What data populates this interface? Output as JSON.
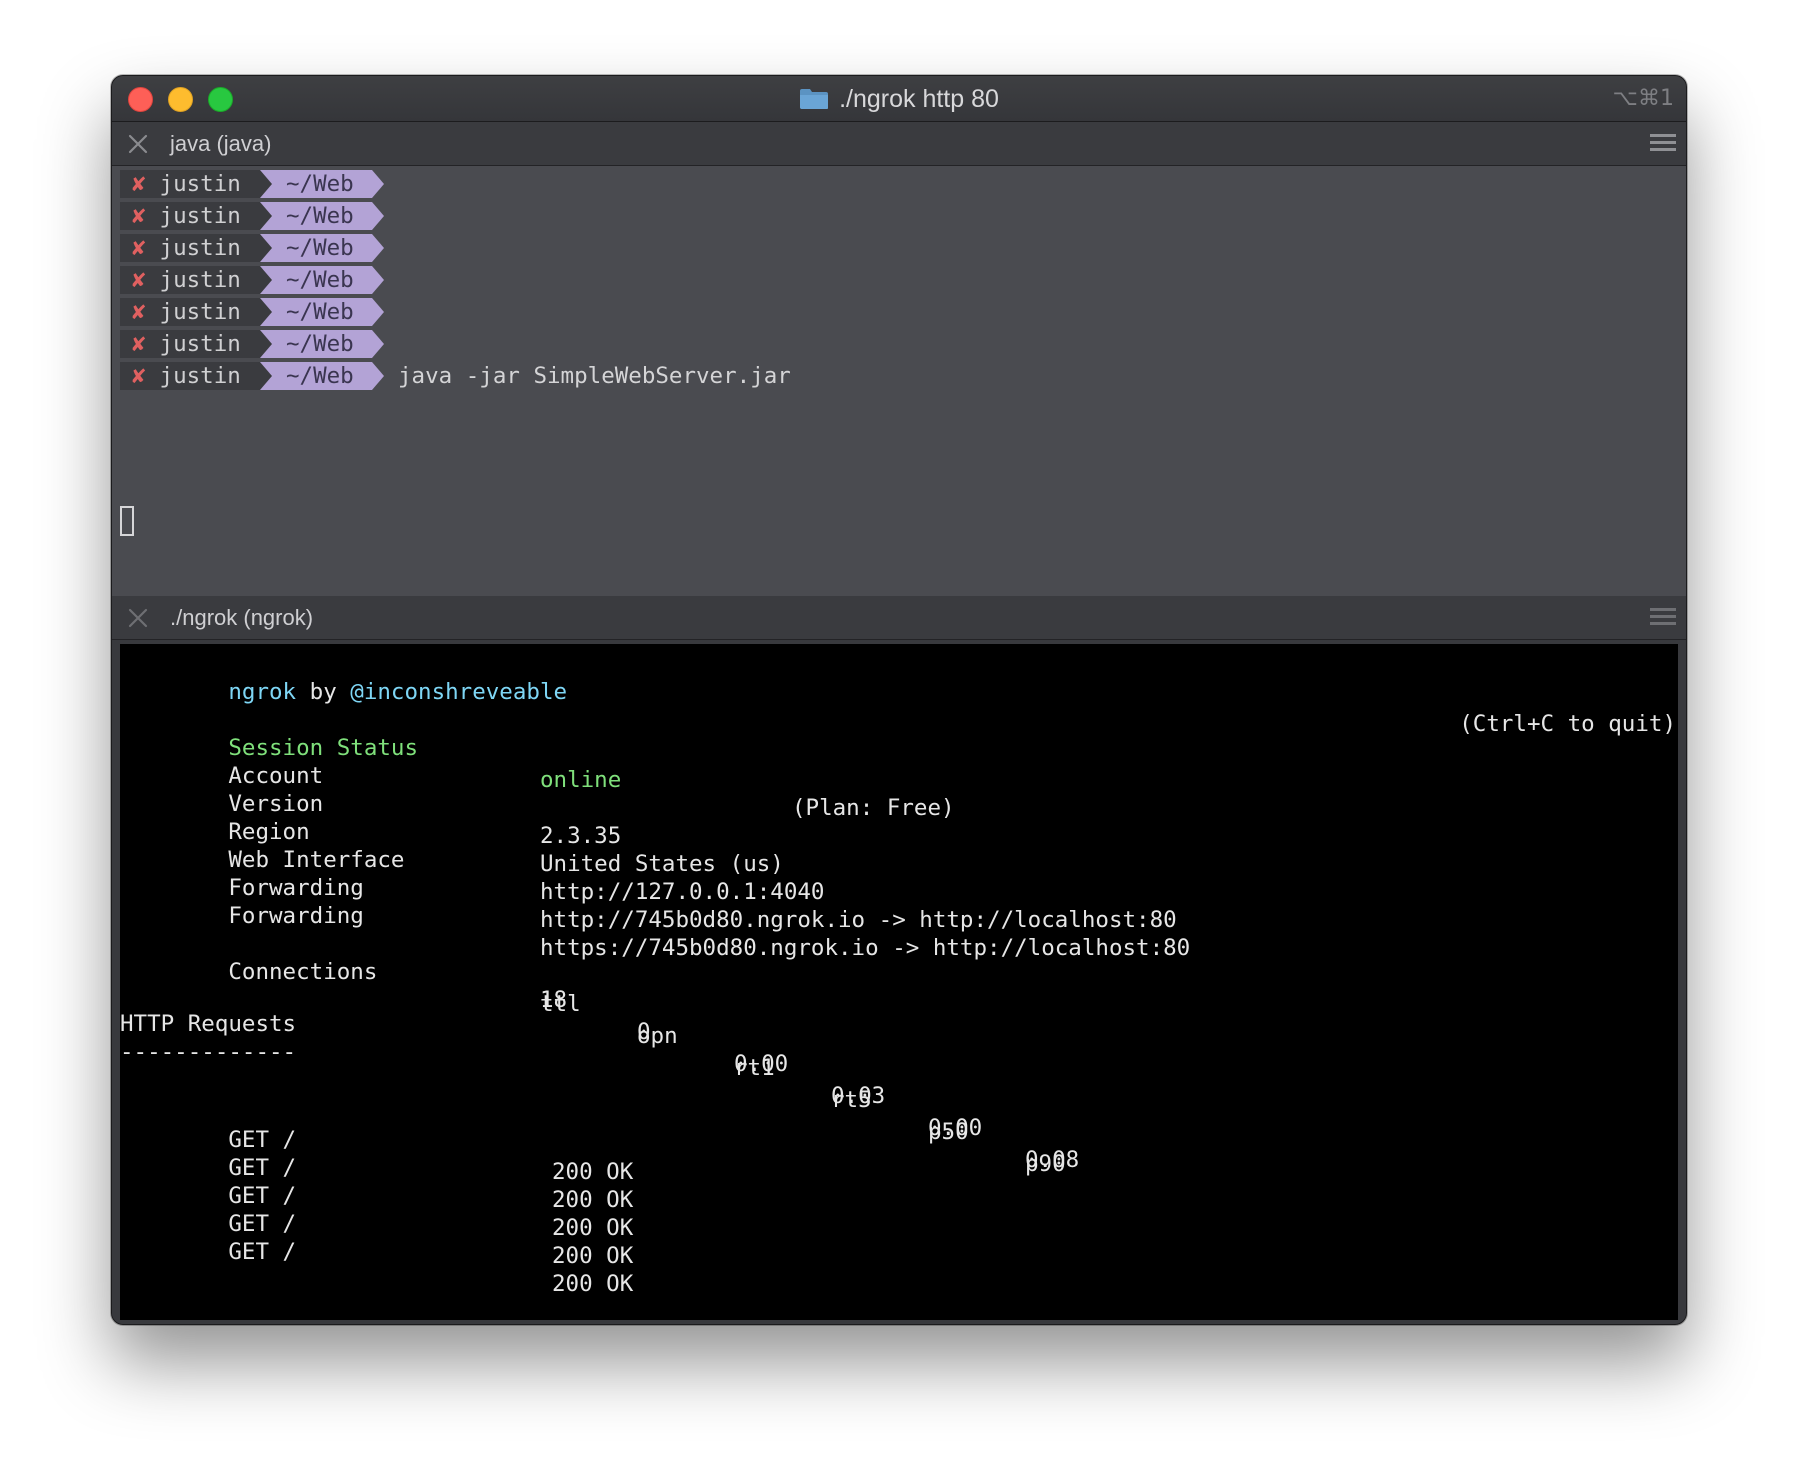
{
  "window": {
    "title": "./ngrok http 80",
    "shortcut": "⌥⌘1"
  },
  "pane_java": {
    "tab_label": "java (java)",
    "prompt_user": "justin",
    "prompt_dir": "~/Web",
    "prompt_mark": "✘",
    "prompt_count": 7,
    "command": "java -jar SimpleWebServer.jar"
  },
  "pane_ngrok": {
    "tab_label": "./ngrok (ngrok)",
    "header": {
      "app": "ngrok",
      "by": " by ",
      "author": "@inconshreveable",
      "quit_hint": "(Ctrl+C to quit)"
    },
    "session_status": {
      "label": "Session Status",
      "value": "online"
    },
    "account": {
      "label": "Account",
      "value": "(Plan: Free)"
    },
    "version": {
      "label": "Version",
      "value": "2.3.35"
    },
    "region": {
      "label": "Region",
      "value": "United States (us)"
    },
    "web_interface": {
      "label": "Web Interface",
      "value": "http://127.0.0.1:4040"
    },
    "forwarding": [
      {
        "label": "Forwarding",
        "value": "http://745b0d80.ngrok.io -> http://localhost:80"
      },
      {
        "label": "Forwarding",
        "value": "https://745b0d80.ngrok.io -> http://localhost:80"
      }
    ],
    "connections": {
      "label": "Connections",
      "headers": [
        "ttl",
        "opn",
        "rt1",
        "rt5",
        "p50",
        "p90"
      ],
      "values": [
        "18",
        "0",
        "0.00",
        "0.03",
        "0.00",
        "0.08"
      ]
    },
    "http_requests": {
      "title": "HTTP Requests",
      "underline": "-------------",
      "rows": [
        {
          "request": "GET /",
          "status": "200 OK"
        },
        {
          "request": "GET /",
          "status": "200 OK"
        },
        {
          "request": "GET /",
          "status": "200 OK"
        },
        {
          "request": "GET /",
          "status": "200 OK"
        },
        {
          "request": "GET /",
          "status": "200 OK"
        }
      ]
    }
  },
  "colors": {
    "accent_cyan": "#7ed6f5",
    "status_green": "#7fe07b",
    "prompt_dir_bg": "#b3a3d6",
    "error_mark": "#e06060"
  }
}
